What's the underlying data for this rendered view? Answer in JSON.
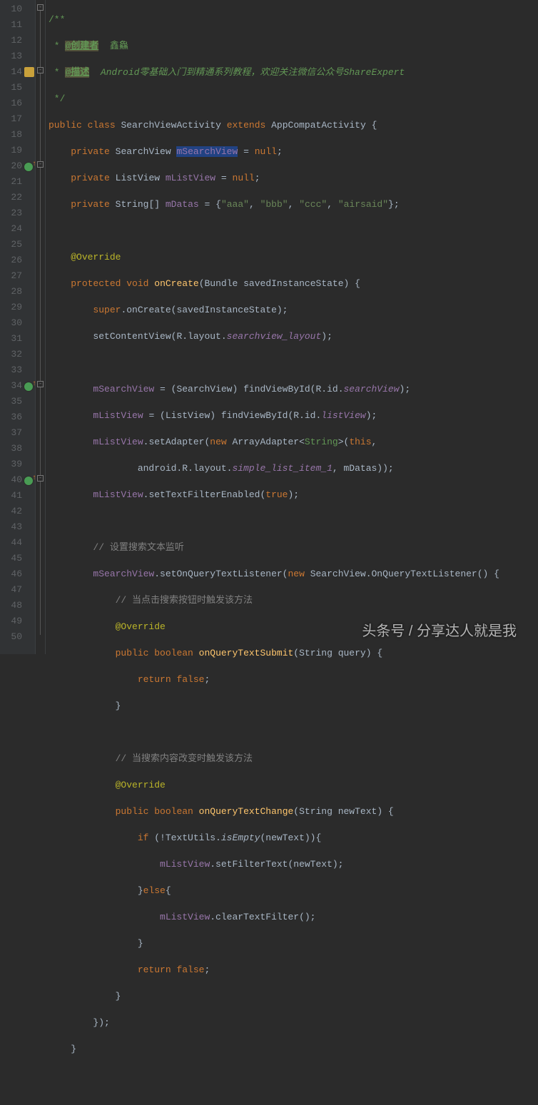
{
  "lines": {
    "start": 10,
    "count": 41
  },
  "doc": {
    "open": "/**",
    "author_tag": "@创建者",
    "author_val": "鑫鱻",
    "desc_tag": "@描述",
    "desc_text1": "Android零基础入门到精通系列教程，欢迎关注微信公众号",
    "desc_text2": "ShareExpert",
    "close": " */"
  },
  "code": {
    "l14": {
      "public": "public",
      "class": "class",
      "name": "SearchViewActivity",
      "extends": "extends",
      "base": "AppCompatActivity",
      "b": "{"
    },
    "l15": {
      "private": "private",
      "type": "SearchView",
      "field": "mSearchView",
      "eq": "=",
      "null": "null",
      "s": ";"
    },
    "l16": {
      "private": "private",
      "type": "ListView",
      "field": "mListView",
      "eq": "=",
      "null": "null",
      "s": ";"
    },
    "l17": {
      "private": "private",
      "type": "String[]",
      "field": "mDatas",
      "eq": "=",
      "ob": "{",
      "a": "\"aaa\"",
      "b": "\"bbb\"",
      "c": "\"ccc\"",
      "d": "\"airsaid\"",
      "cb": "}",
      "s": ";",
      "comma": ", "
    },
    "l19": {
      "ann": "@Override"
    },
    "l20": {
      "protected": "protected",
      "void": "void",
      "fn": "onCreate",
      "p": "(Bundle savedInstanceState) {"
    },
    "l21": {
      "super": "super",
      "rest": ".onCreate(savedInstanceState);"
    },
    "l22": {
      "txt": "setContentView(R.layout.",
      "it": "searchview_layout",
      "end": ");"
    },
    "l24": {
      "f": "mSearchView",
      "txt": " = (SearchView) findViewById(R.id.",
      "it": "searchView",
      "end": ");"
    },
    "l25": {
      "f": "mListView",
      "txt": " = (ListView) findViewById(R.id.",
      "it": "listView",
      "end": ");"
    },
    "l26": {
      "f": "mListView",
      "txt": ".setAdapter(",
      "new": "new",
      "txt2": " ArrayAdapter<",
      "ty": "String",
      "txt3": ">(",
      "this": "this",
      "end": ","
    },
    "l27": {
      "txt": "android.R.layout.",
      "it": "simple_list_item_1",
      "txt2": ", mDatas));"
    },
    "l28": {
      "f": "mListView",
      "txt": ".setTextFilterEnabled(",
      "true": "true",
      "end": ");"
    },
    "l30": {
      "com": "// 设置搜索文本监听"
    },
    "l31": {
      "f": "mSearchView",
      "txt": ".setOnQueryTextListener(",
      "new": "new",
      "txt2": " SearchView.OnQueryTextListener() {"
    },
    "l32": {
      "com": "// 当点击搜索按钮时触发该方法"
    },
    "l33": {
      "ann": "@Override"
    },
    "l34": {
      "public": "public",
      "bool": "boolean",
      "fn": "onQueryTextSubmit",
      "p": "(String query) {"
    },
    "l35": {
      "return": "return",
      "false": "false",
      "s": ";"
    },
    "l36": {
      "b": "}"
    },
    "l38": {
      "com": "// 当搜索内容改变时触发该方法"
    },
    "l39": {
      "ann": "@Override"
    },
    "l40": {
      "public": "public",
      "bool": "boolean",
      "fn": "onQueryTextChange",
      "p": "(String newText) {"
    },
    "l41": {
      "if": "if",
      "txt": " (!TextUtils.",
      "it": "isEmpty",
      "txt2": "(newText)){"
    },
    "l42": {
      "f": "mListView",
      "txt": ".setFilterText(newText);"
    },
    "l43": {
      "b": "}",
      "else": "else",
      "b2": "{"
    },
    "l44": {
      "f": "mListView",
      "txt": ".clearTextFilter();"
    },
    "l45": {
      "b": "}"
    },
    "l46": {
      "return": "return",
      "false": "false",
      "s": ";"
    },
    "l47": {
      "b": "}"
    },
    "l48": {
      "b": "});"
    },
    "l49": {
      "b": "}"
    }
  },
  "watermark": "头条号 / 分享达人就是我"
}
